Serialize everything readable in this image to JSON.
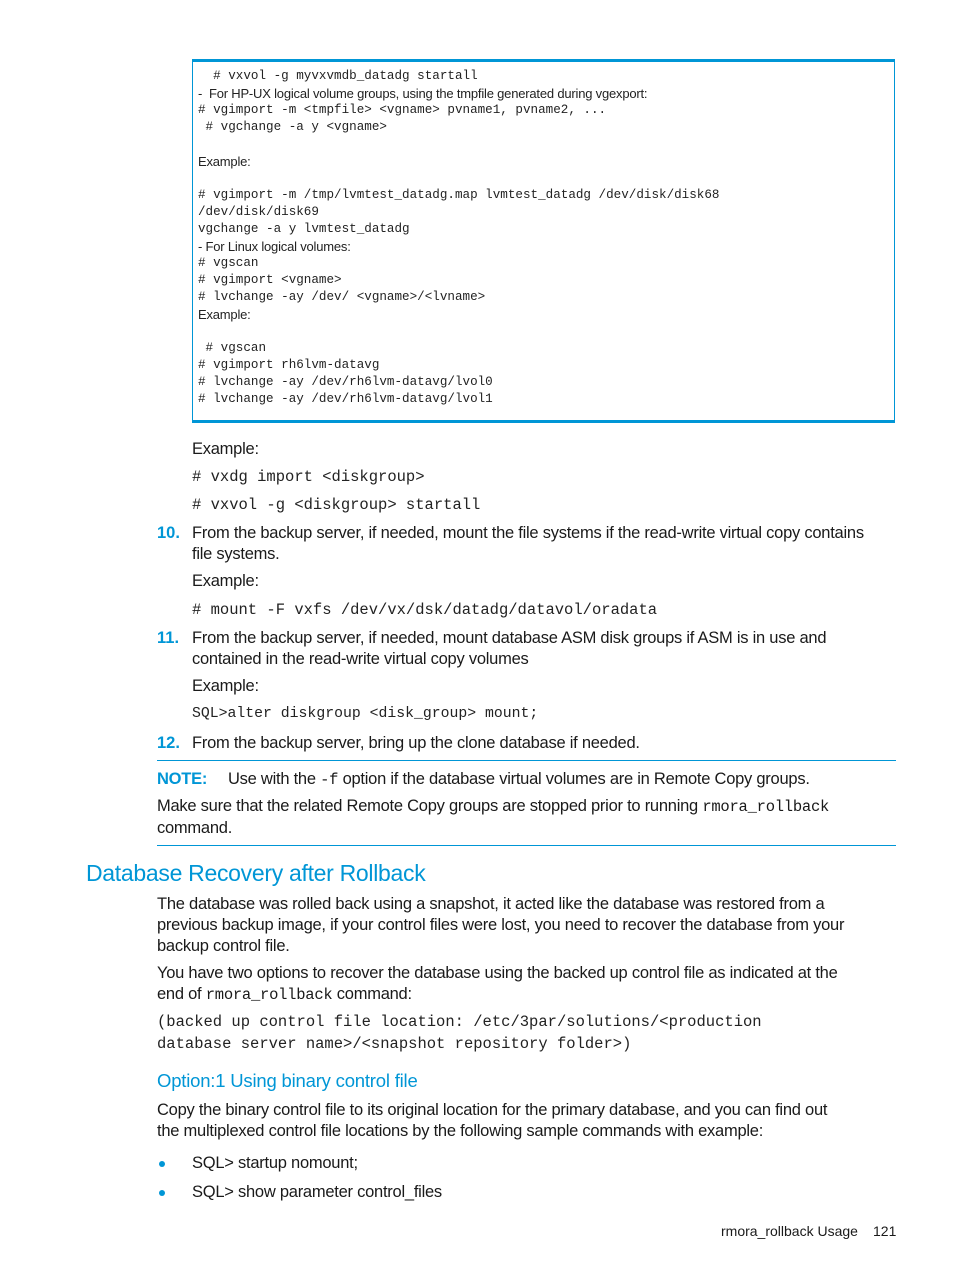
{
  "code_box": {
    "lines": [
      {
        "text": "  # vxvol -g myvxvmdb_datadg startall",
        "style": "mono"
      },
      {
        "text": "-  For HP-UX logical volume groups, using the tmpfile generated during vgexport:",
        "style": "sans"
      },
      {
        "text": "# vgimport -m <tmpfile> <vgname> pvname1, pvname2, ...",
        "style": "mono"
      },
      {
        "text": " # vgchange -a y <vgname>",
        "style": "mono"
      },
      {
        "text": "",
        "style": "mono"
      },
      {
        "text": "Example:",
        "style": "sans"
      },
      {
        "text": "",
        "style": "mono"
      },
      {
        "text": "# vgimport -m /tmp/lvmtest_datadg.map lvmtest_datadg /dev/disk/disk68",
        "style": "mono"
      },
      {
        "text": "/dev/disk/disk69",
        "style": "mono"
      },
      {
        "text": "vgchange -a y lvmtest_datadg",
        "style": "mono"
      },
      {
        "text": "- For Linux logical volumes:",
        "style": "sans"
      },
      {
        "text": "# vgscan",
        "style": "mono"
      },
      {
        "text": "# vgimport <vgname>",
        "style": "mono"
      },
      {
        "text": "# lvchange -ay /dev/ <vgname>/<lvname>",
        "style": "mono"
      },
      {
        "text": "Example:",
        "style": "sans"
      },
      {
        "text": "",
        "style": "mono"
      },
      {
        "text": " # vgscan",
        "style": "mono"
      },
      {
        "text": "# vgimport rh6lvm-datavg",
        "style": "mono"
      },
      {
        "text": "# lvchange -ay /dev/rh6lvm-datavg/lvol0",
        "style": "mono"
      },
      {
        "text": "# lvchange -ay /dev/rh6lvm-datavg/lvol1",
        "style": "mono"
      }
    ]
  },
  "vx_example": {
    "label": "Example:",
    "cmd1": "# vxdg import <diskgroup>",
    "cmd2": "# vxvol -g <diskgroup> startall"
  },
  "steps": [
    {
      "number": "10.",
      "line1": "From the backup server, if needed, mount the file systems if the read-write virtual copy contains",
      "line2": "file systems.",
      "example_label": "Example:",
      "example_cmd": "# mount -F vxfs /dev/vx/dsk/datadg/datavol/oradata"
    },
    {
      "number": "11.",
      "line1": "From the backup server, if needed, mount database ASM disk groups if ASM is in use and",
      "line2": "contained in the read-write virtual copy volumes",
      "example_label": "Example:",
      "example_cmd": "SQL>alter diskgroup <disk_group> mount;"
    },
    {
      "number": "12.",
      "line1": "From the backup server, bring up the clone database if needed."
    }
  ],
  "note": {
    "label": "NOTE:",
    "line1_pre": "Use with the ",
    "line1_code": "-f",
    "line1_post": " option if the database virtual volumes are in Remote Copy groups.",
    "line2_pre": "Make sure that the related Remote Copy groups are stopped prior to running ",
    "line2_code": "rmora_rollback",
    "line3": "command."
  },
  "section": {
    "title": "Database Recovery after Rollback",
    "para1": [
      "The database was rolled back using a snapshot, it acted like the database was restored from a",
      "previous backup image, if your control files were lost, you need to recover the database from your",
      "backup control file."
    ],
    "para2_line1": "You have two options to recover the database using the backed up control file as indicated at the",
    "para2_line2_pre": "end of ",
    "para2_line2_code": "rmora_rollback",
    "para2_line2_post": " command:",
    "code_line1": "(backed up control file location: /etc/3par/solutions/<production",
    "code_line2": "database server name>/<snapshot repository folder>)"
  },
  "subsection": {
    "title": "Option:1 Using binary control file",
    "para": [
      "Copy the binary control file to its original location for the primary database, and you can find out",
      "the multiplexed control file locations by the following sample commands with example:"
    ],
    "bullets": [
      "SQL> startup nomount;",
      "SQL> show parameter control_files"
    ]
  },
  "footer": {
    "section_name": "rmora_rollback Usage",
    "page_number": "121"
  }
}
